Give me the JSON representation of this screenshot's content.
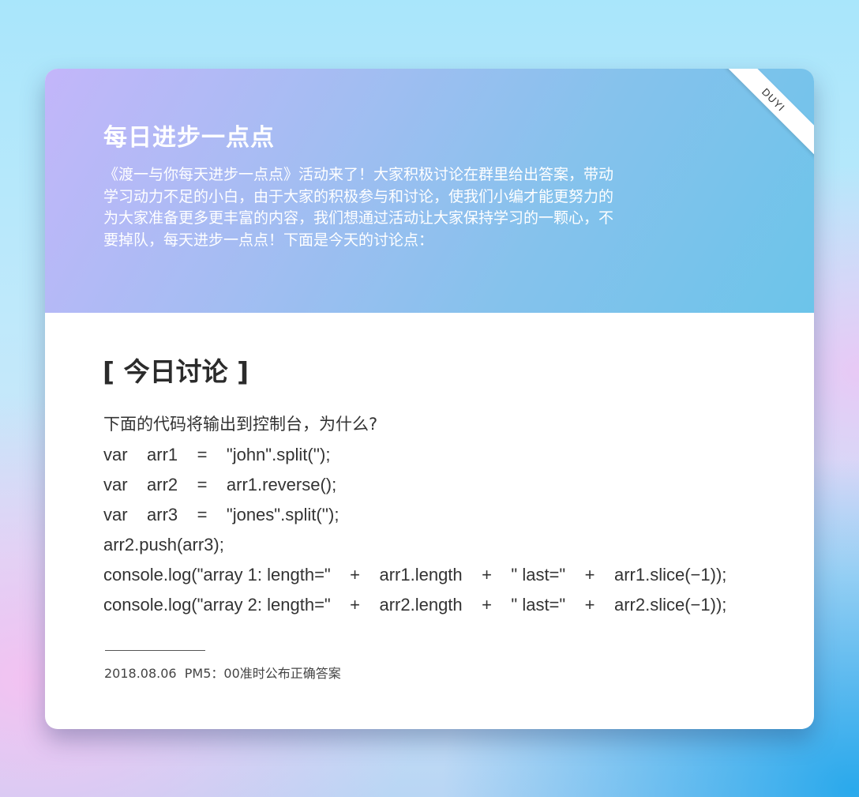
{
  "header": {
    "title": "每日进步一点点",
    "intro": "《渡一与你每天进步一点点》活动来了！大家积极讨论在群里给出答案，带动\n学习动力不足的小白，由于大家的积极参与和讨论，使我们小编才能更努力的\n为大家准备更多更丰富的内容，我们想通过活动让大家保持学习的一颗心，不\n要掉队，每天进步一点点！下面是今天的讨论点：",
    "ribbon": "DUYI"
  },
  "discussion": {
    "title": "[ 今日讨论 ]",
    "question": "下面的代码将输出到控制台，为什么?",
    "code_lines": [
      "var    arr1    =    \"john\".split('');",
      "var    arr2    =    arr1.reverse();",
      "var    arr3    =    \"jones\".split('');",
      "arr2.push(arr3);",
      "console.log(\"array 1: length=\"    +    arr1.length    +    \" last=\"    +    arr1.slice(−1));",
      "console.log(\"array 2: length=\"    +    arr2.length    +    \" last=\"    +    arr2.slice(−1));"
    ],
    "footnote": "2018.08.06  PM5：00准时公布正确答案"
  },
  "colors": {
    "header_gradient_start": "#c3b6fa",
    "header_gradient_end": "#6cc4ea",
    "card_background": "#ffffff",
    "text_dark": "#333333"
  }
}
